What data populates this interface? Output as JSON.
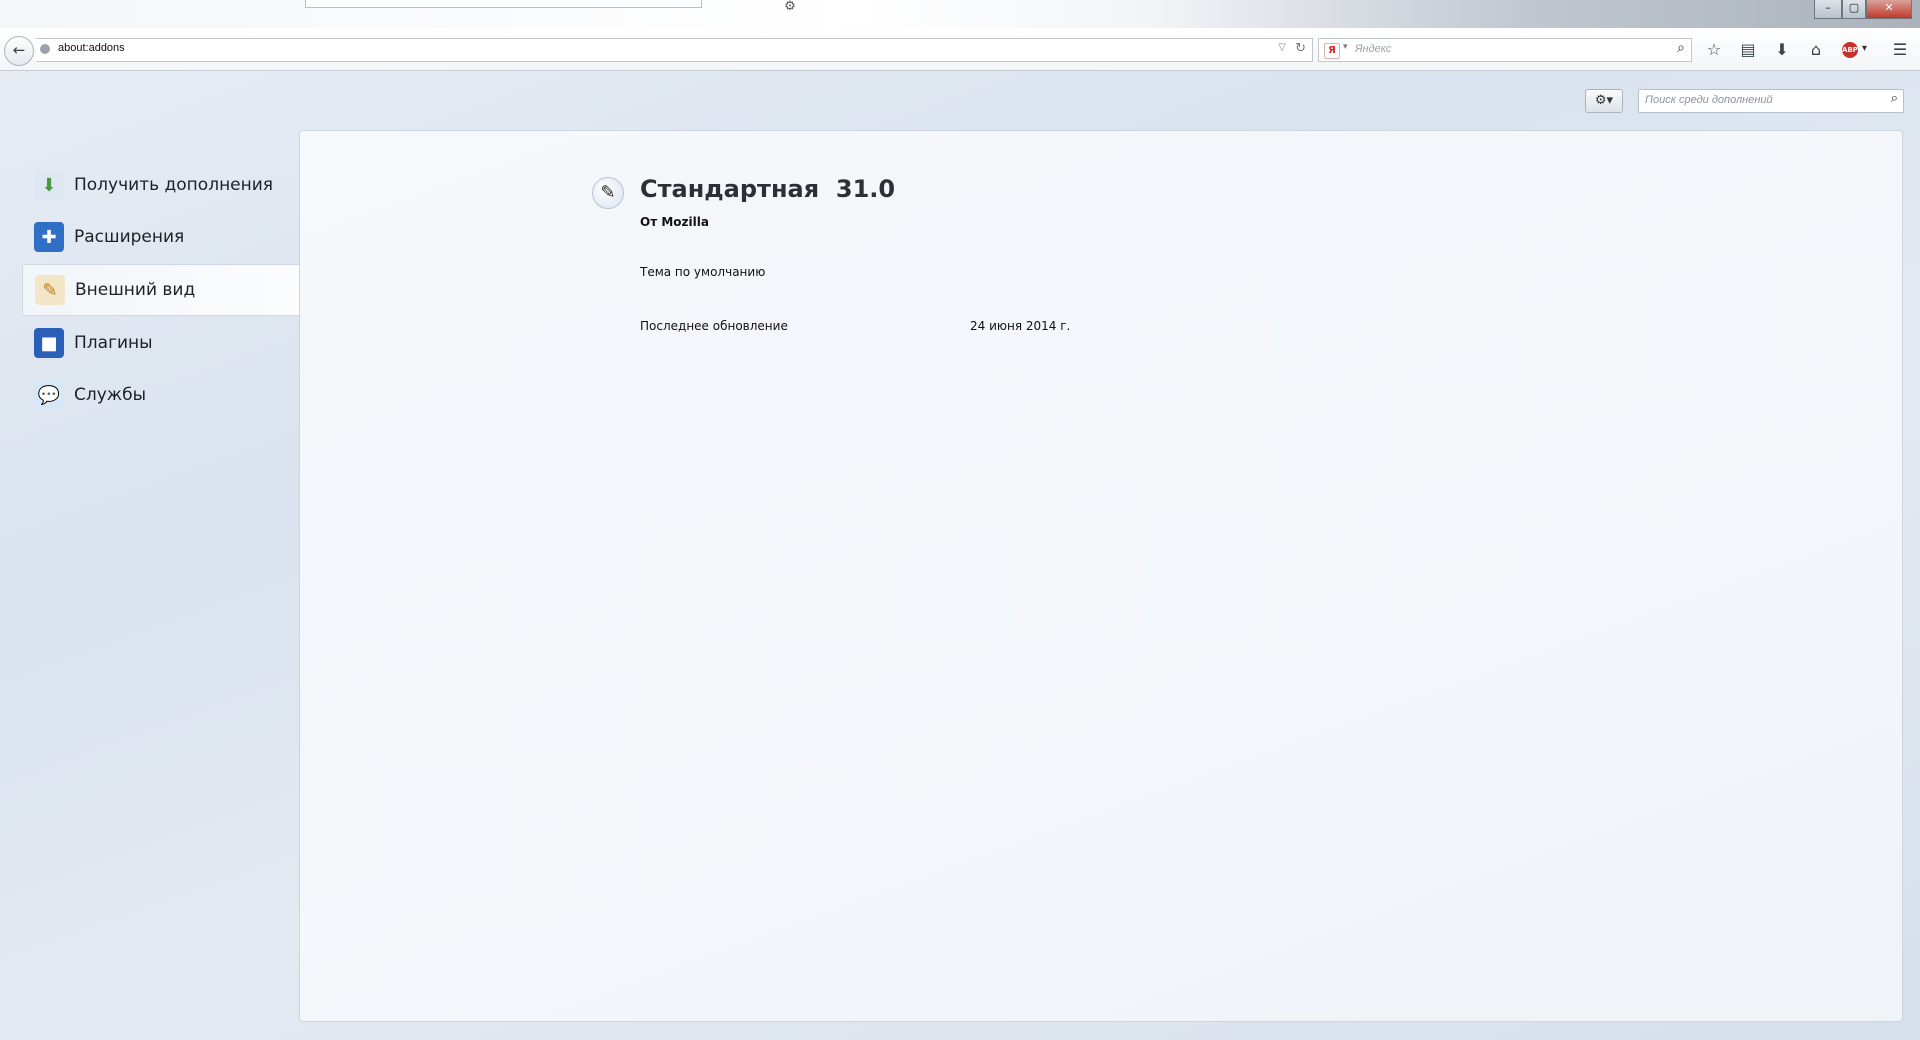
{
  "window": {
    "controls": {
      "minimize": "–",
      "maximize": "▢",
      "close": "✕"
    }
  },
  "tab": {
    "icon": "gear-icon"
  },
  "navbar": {
    "url": "about:addons",
    "search_engine_logo": "Я",
    "search_placeholder": "Яндекс",
    "abp_badge": "ABP"
  },
  "addons": {
    "search_placeholder": "Поиск среди дополнений",
    "categories": [
      {
        "label": "Получить дополнения",
        "icon": "get-addons-icon",
        "color": "#4a9a3c"
      },
      {
        "label": "Расширения",
        "icon": "puzzle-icon",
        "color": "#2f6fc6"
      },
      {
        "label": "Внешний вид",
        "icon": "appearance-icon",
        "color": "#e0a020",
        "selected": true
      },
      {
        "label": "Плагины",
        "icon": "plugin-icon",
        "color": "#2b5fb8"
      },
      {
        "label": "Службы",
        "icon": "services-icon",
        "color": "#3d8fd6"
      }
    ],
    "detail": {
      "name": "Стандартная",
      "version": "31.0",
      "creator_prefix": "От",
      "creator": "Mozilla",
      "description": "Тема по умолчанию",
      "last_updated_label": "Последнее обновление",
      "last_updated_value": "24 июня 2014 г."
    }
  }
}
